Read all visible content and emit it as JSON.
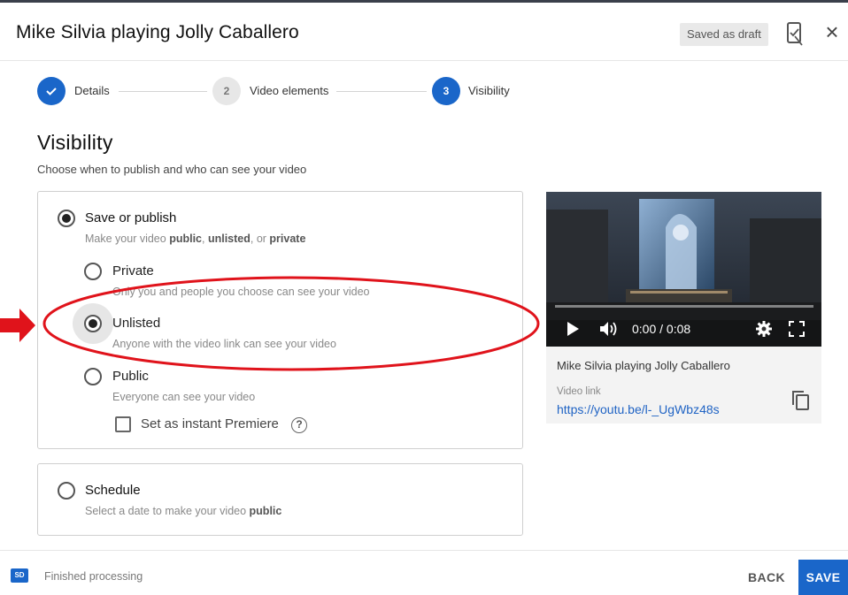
{
  "header": {
    "title": "Mike Silvia playing Jolly Caballero",
    "draft_status": "Saved as draft"
  },
  "stepper": {
    "steps": [
      {
        "label": "Details",
        "number": "",
        "state": "done"
      },
      {
        "label": "Video elements",
        "number": "2",
        "state": "todo"
      },
      {
        "label": "Visibility",
        "number": "3",
        "state": "active"
      }
    ]
  },
  "visibility": {
    "title": "Visibility",
    "subtitle": "Choose when to publish and who can see your video",
    "save_or_publish": {
      "label": "Save or publish",
      "desc_prefix": "Make your video ",
      "desc_public": "public",
      "desc_sep1": ", ",
      "desc_unlisted": "unlisted",
      "desc_sep2": ", or ",
      "desc_private": "private",
      "selected": true
    },
    "options": [
      {
        "label": "Private",
        "desc": "Only you and people you choose can see your video",
        "selected": false
      },
      {
        "label": "Unlisted",
        "desc": "Anyone with the video link can see your video",
        "selected": true
      },
      {
        "label": "Public",
        "desc": "Everyone can see your video",
        "selected": false
      }
    ],
    "premiere": {
      "label": "Set as instant Premiere",
      "checked": false
    },
    "schedule": {
      "label": "Schedule",
      "desc_prefix": "Select a date to make your video ",
      "desc_bold": "public",
      "selected": false
    }
  },
  "preview": {
    "time": "0:00 / 0:08",
    "title": "Mike Silvia playing Jolly Caballero",
    "link_caption": "Video link",
    "link": "https://youtu.be/l-_UgWbz48s"
  },
  "footer": {
    "processing_badge": "SD",
    "status": "Finished processing",
    "back_label": "BACK",
    "save_label": "SAVE"
  },
  "colors": {
    "accent": "#1a66c9",
    "annotation_red": "#e0131b"
  },
  "icons": {
    "feedback": "feedback-icon",
    "close": "close-icon",
    "check": "check-icon",
    "play": "play-icon",
    "volume": "volume-icon",
    "settings": "gear-icon",
    "fullscreen": "fullscreen-icon",
    "copy": "copy-icon",
    "help": "help-icon"
  }
}
